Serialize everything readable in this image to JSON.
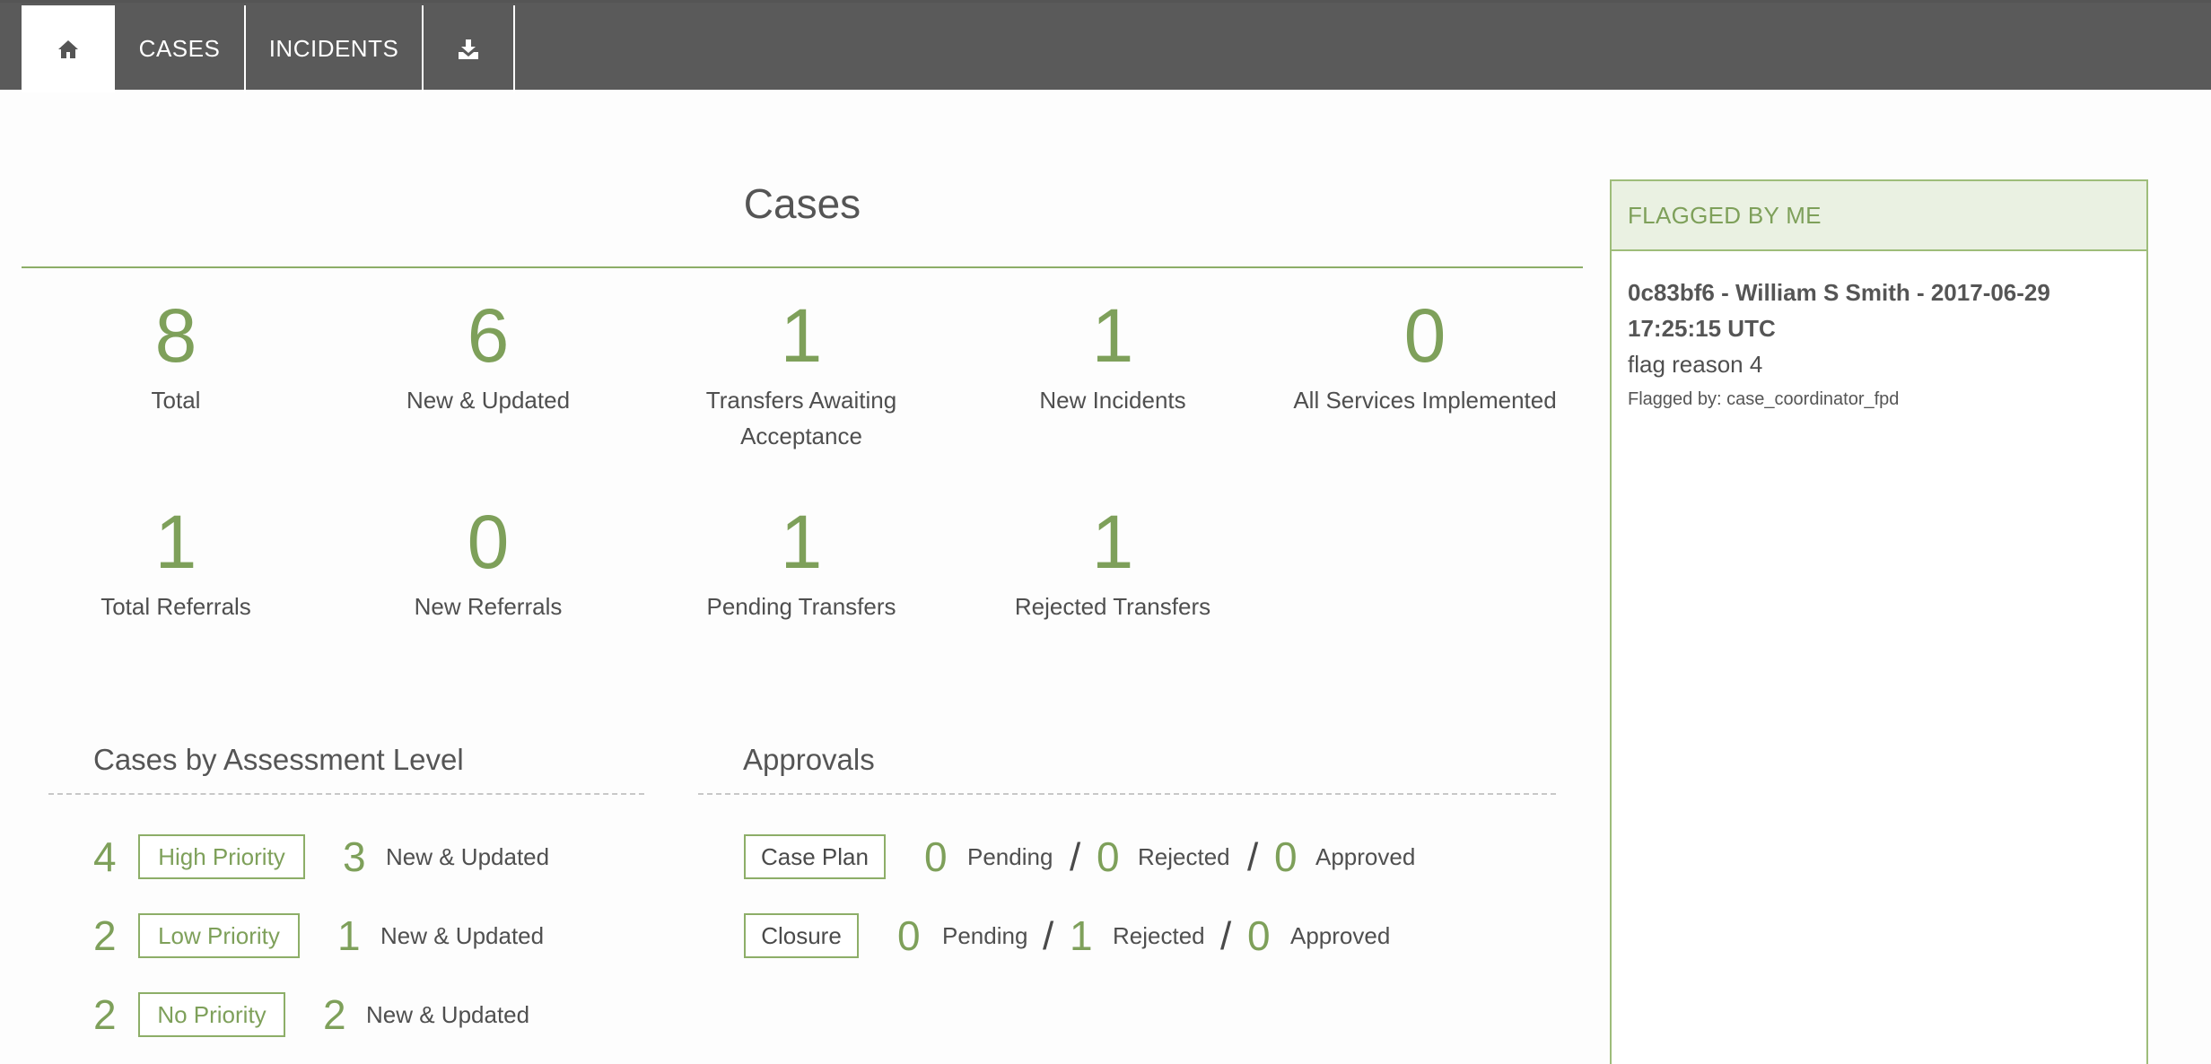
{
  "nav": {
    "home_icon": "home-icon",
    "cases": "CASES",
    "incidents": "INCIDENTS",
    "download_icon": "download-icon"
  },
  "cases": {
    "title": "Cases",
    "stats": [
      {
        "value": "8",
        "label": "Total"
      },
      {
        "value": "6",
        "label": "New & Updated"
      },
      {
        "value": "1",
        "label": "Transfers Awaiting Acceptance"
      },
      {
        "value": "1",
        "label": "New Incidents"
      },
      {
        "value": "0",
        "label": "All Services Implemented"
      },
      {
        "value": "1",
        "label": "Total Referrals"
      },
      {
        "value": "0",
        "label": "New Referrals"
      },
      {
        "value": "1",
        "label": "Pending Transfers"
      },
      {
        "value": "1",
        "label": "Rejected Transfers"
      }
    ]
  },
  "assessment": {
    "title": "Cases by Assessment Level",
    "rows": [
      {
        "count": "4",
        "level": "High Priority",
        "new_count": "3",
        "new_label": "New & Updated"
      },
      {
        "count": "2",
        "level": "Low Priority",
        "new_count": "1",
        "new_label": "New & Updated"
      },
      {
        "count": "2",
        "level": "No Priority",
        "new_count": "2",
        "new_label": "New & Updated"
      }
    ]
  },
  "approvals": {
    "title": "Approvals",
    "rows": [
      {
        "type": "Case Plan",
        "pending": "0",
        "pending_label": "Pending",
        "rejected": "0",
        "rejected_label": "Rejected",
        "approved": "0",
        "approved_label": "Approved"
      },
      {
        "type": "Closure",
        "pending": "0",
        "pending_label": "Pending",
        "rejected": "1",
        "rejected_label": "Rejected",
        "approved": "0",
        "approved_label": "Approved"
      }
    ]
  },
  "flagged": {
    "title": "FLAGGED BY ME",
    "items": [
      {
        "case": "0c83bf6 - William S Smith - 2017-06-29 17:25:15 UTC",
        "reason": "flag reason 4",
        "by": "Flagged by: case_coordinator_fpd"
      }
    ]
  },
  "colors": {
    "accent_green": "#7ea05a",
    "nav_bg": "#5a5a5a",
    "panel_header_bg": "#eaf1e2"
  }
}
